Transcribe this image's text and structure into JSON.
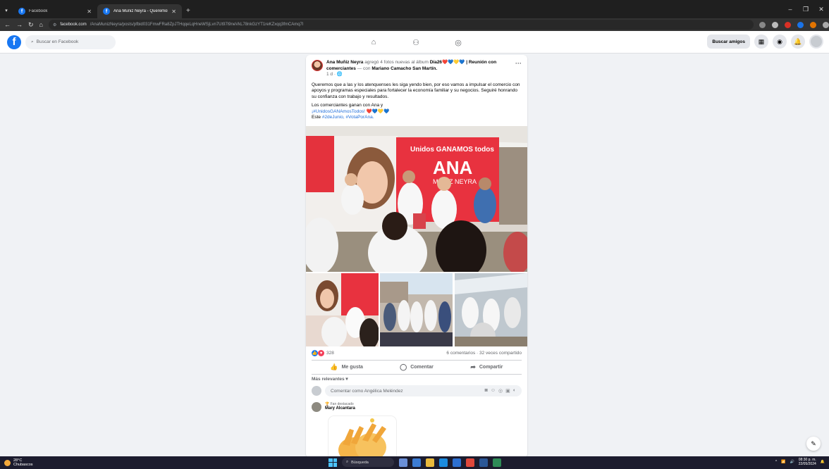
{
  "browser": {
    "tabs": [
      {
        "label": "Facebook",
        "active": false
      },
      {
        "label": "Ana Muñiz Neyra - Queremos q...",
        "active": true
      }
    ],
    "url_host": "facebook.com",
    "url_path": "/AnaMunizNeyra/posts/pfbid031FmwFRa8ZpJTHqqeLqHneWSjLvn7Ut97i9neVkL78nkGzYT1reKZxqq3fmCAmq7l"
  },
  "fb_header": {
    "logo": "f",
    "search_placeholder": "Buscar en Facebook",
    "find_friends": "Buscar amigos"
  },
  "post": {
    "author": "Ana Muñiz Neyra",
    "action_text": "agregó 4 fotos nuevas al álbum",
    "album_title": "Día26❤️💙💛💙 | Reunión con comerciantes",
    "with_text": "— con",
    "with_person": "Mariano Camacho San Martín.",
    "time": "1 d ·",
    "paragraph1": "Queremos que a las y los atenquenses les siga yendo bien, por eso vamos a impulsar el comercio con apoyos y programas especiales para fortalecer la economía familiar y su negocios. Seguiré honrando su confianza con trabajo y resultados.",
    "line1": "Los comerciantes ganan con Ana y",
    "line2": "¡#UnidosGANAmosTodos! ❤️💙💛💙",
    "line3_prefix": "Este",
    "line3_tags": "#2deJunio, #VotaPorAna.",
    "banner_text1": "Unidos GANAMOS todos",
    "banner_text2": "ANA",
    "banner_text3": "MUÑIZ NEYRA",
    "reaction_count": "328",
    "comments_shares": "6 comentarios · 32 veces compartido",
    "like_label": "Me gusta",
    "comment_label": "Comentar",
    "share_label": "Compartir",
    "sort_label": "Más relevantes ▾",
    "comment_placeholder": "Comentar como Angélica Meléndez",
    "comment": {
      "badge": "🏆 Fan destacado",
      "name": "Mary Alcantara"
    }
  },
  "taskbar": {
    "temp": "28°C",
    "weather_desc": "Chubascos",
    "search_label": "Búsqueda",
    "time": "08:30 p. m.",
    "date": "22/05/2024"
  },
  "colors": {
    "fb_blue": "#1877f2",
    "banner_red": "#e8323f"
  }
}
